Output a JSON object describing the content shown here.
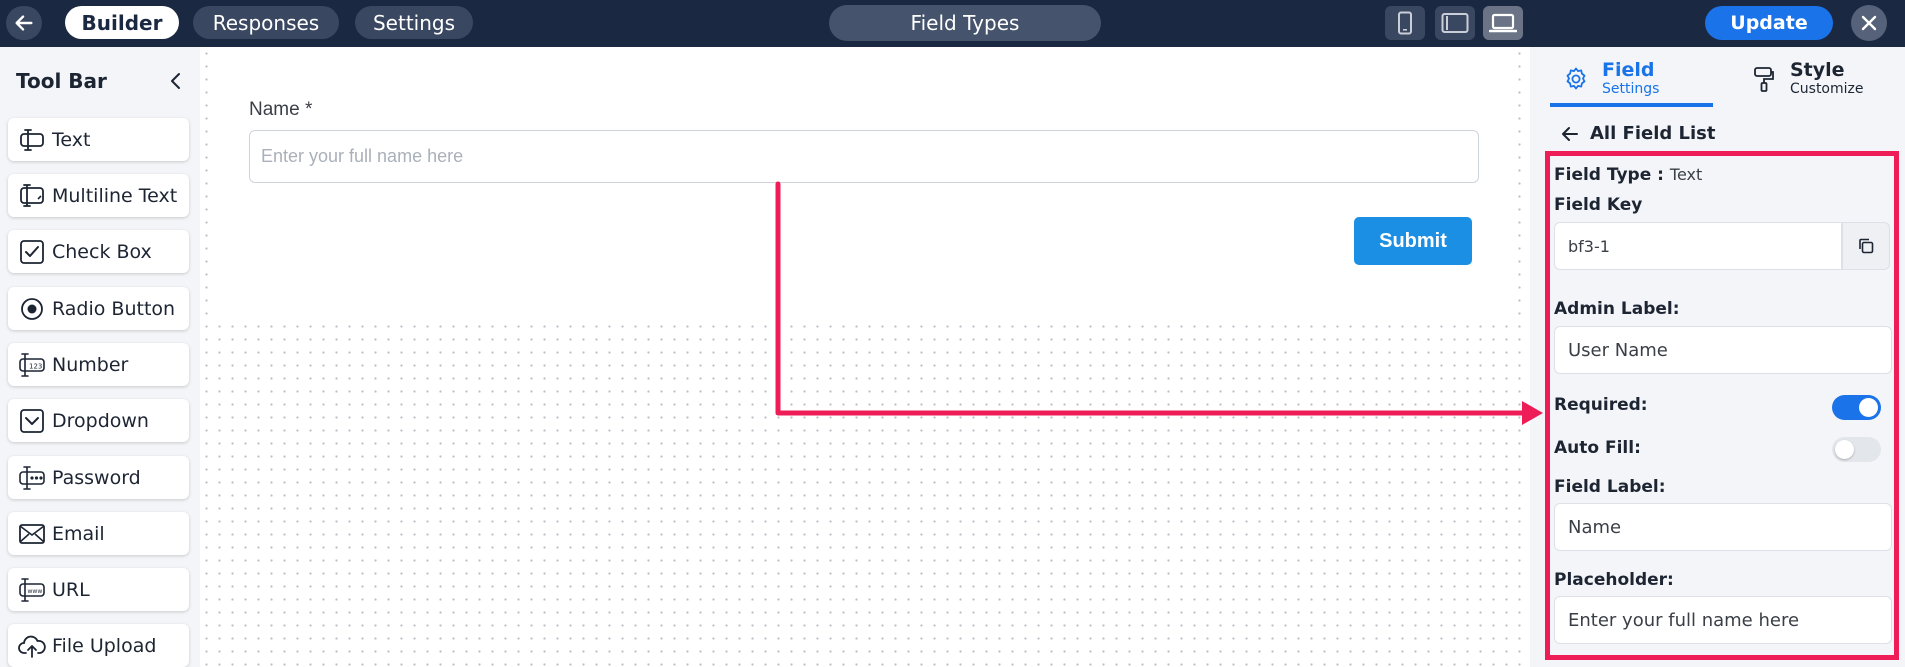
{
  "topbar": {
    "tabs": [
      {
        "label": "Builder"
      },
      {
        "label": "Responses"
      },
      {
        "label": "Settings"
      }
    ],
    "title": "Field Types",
    "update_label": "Update"
  },
  "toolbar": {
    "title": "Tool Bar",
    "items": [
      {
        "label": "Text",
        "icon": "text-field-icon"
      },
      {
        "label": "Multiline Text",
        "icon": "multiline-text-icon"
      },
      {
        "label": "Check Box",
        "icon": "checkbox-icon"
      },
      {
        "label": "Radio Button",
        "icon": "radio-button-icon"
      },
      {
        "label": "Number",
        "icon": "number-icon"
      },
      {
        "label": "Dropdown",
        "icon": "dropdown-icon"
      },
      {
        "label": "Password",
        "icon": "password-icon"
      },
      {
        "label": "Email",
        "icon": "email-icon"
      },
      {
        "label": "URL",
        "icon": "url-icon"
      },
      {
        "label": "File Upload",
        "icon": "file-upload-icon"
      }
    ]
  },
  "form": {
    "name_label": "Name *",
    "name_placeholder": "Enter your full name here",
    "submit_label": "Submit"
  },
  "panel": {
    "tabs": [
      {
        "title": "Field",
        "subtitle": "Settings"
      },
      {
        "title": "Style",
        "subtitle": "Customize"
      }
    ],
    "back_label": "All Field List",
    "field_type_label": "Field Type :",
    "field_type_value": "Text",
    "field_key_label": "Field Key",
    "field_key_value": "bf3-1",
    "admin_label_label": "Admin Label:",
    "admin_label_value": "User Name",
    "required_label": "Required:",
    "required_on": true,
    "auto_fill_label": "Auto Fill:",
    "auto_fill_on": false,
    "field_label_label": "Field Label:",
    "field_label_value": "Name",
    "placeholder_label": "Placeholder:",
    "placeholder_value": "Enter your full name here"
  },
  "colors": {
    "topbar_bg": "#1b2841",
    "accent_blue": "#1a73e8",
    "annotation_red": "#ee1d58"
  }
}
